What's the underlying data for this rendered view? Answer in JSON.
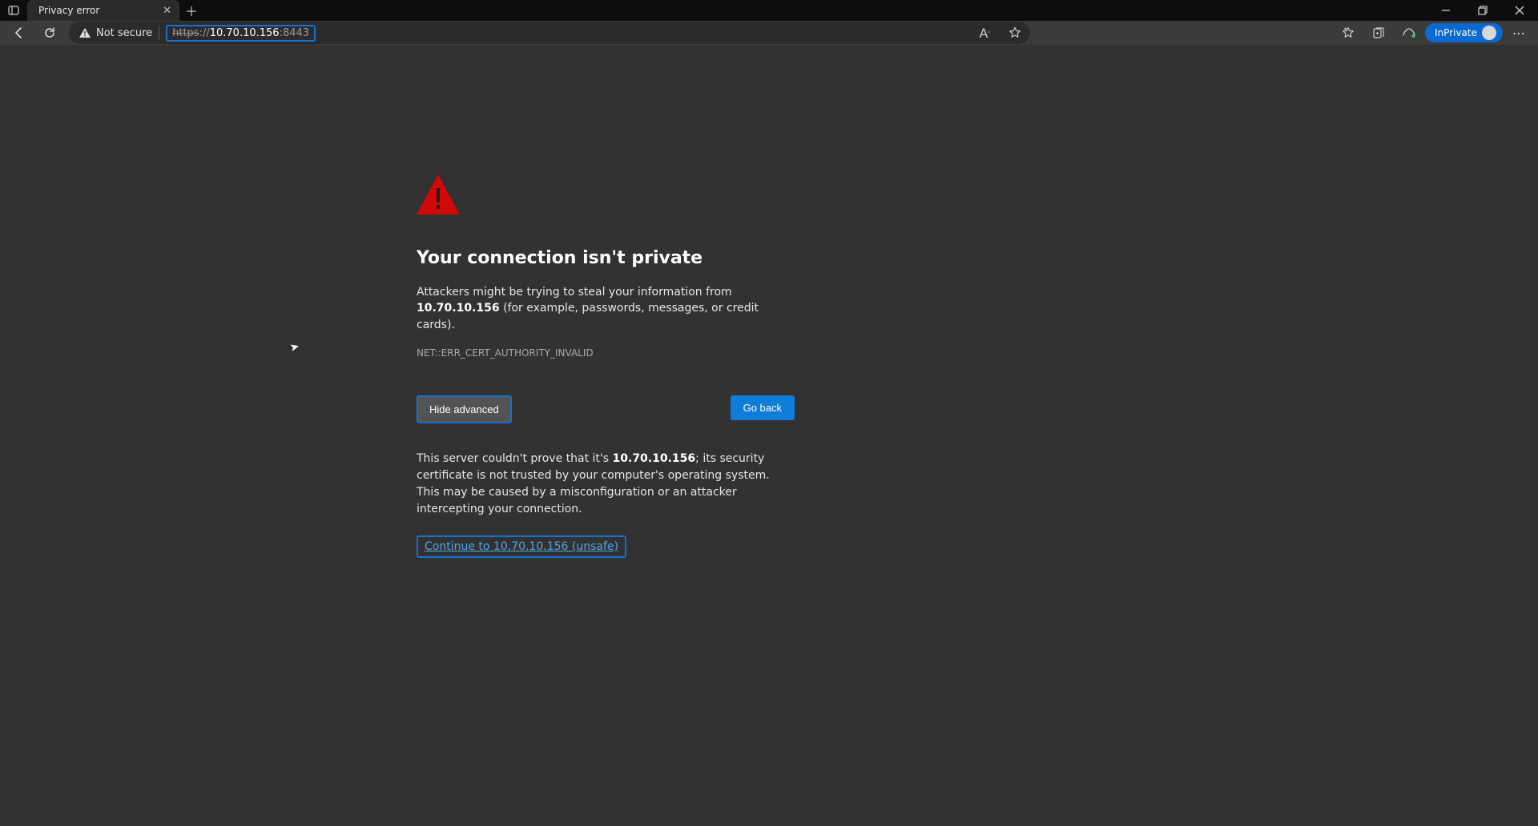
{
  "tab": {
    "title": "Privacy error"
  },
  "toolbar": {
    "not_secure": "Not secure",
    "url_scheme": "https",
    "url_sep": "://",
    "url_host": "10.70.10.156",
    "url_port": ":8443",
    "inprivate_label": "InPrivate"
  },
  "page": {
    "heading": "Your connection isn't private",
    "warn_prefix": "Attackers might be trying to steal your information from ",
    "host_bold": "10.70.10.156",
    "warn_suffix": " (for example, passwords, messages, or credit cards).",
    "error_code": "NET::ERR_CERT_AUTHORITY_INVALID",
    "hide_label": "Hide advanced",
    "goback_label": "Go back",
    "adv_prefix": "This server couldn't prove that it's ",
    "adv_host": "10.70.10.156",
    "adv_suffix": "; its security certificate is not trusted by your computer's operating system. This may be caused by a misconfiguration or an attacker intercepting your connection.",
    "continue_label": "Continue to 10.70.10.156 (unsafe)"
  }
}
